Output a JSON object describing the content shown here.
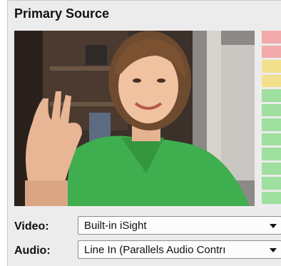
{
  "panel": {
    "title": "Primary Source"
  },
  "video_preview": {
    "description_icon": "camera-feed"
  },
  "level_meter": {
    "segments": [
      "#f2a9a9",
      "#f2a9a9",
      "#f3e08d",
      "#f3e08d",
      "#9fdf9f",
      "#9fdf9f",
      "#9fdf9f",
      "#9fdf9f",
      "#9fdf9f",
      "#9fdf9f",
      "#9fdf9f",
      "#9fdf9f"
    ]
  },
  "video": {
    "label": "Video:",
    "selected": "Built-in iSight"
  },
  "audio": {
    "label": "Audio:",
    "selected": "Line In (Parallels Audio Contrı"
  }
}
